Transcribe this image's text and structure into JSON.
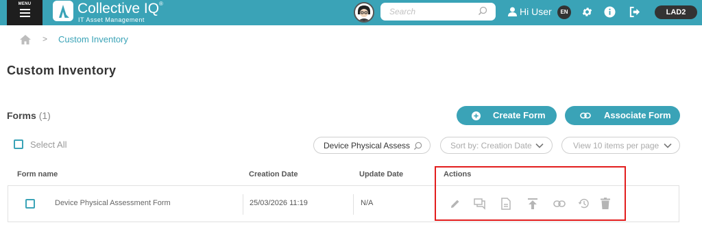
{
  "header": {
    "menu_label": "MENU",
    "app_title": "Collective IQ",
    "app_registered": "®",
    "app_subtitle": "IT Asset Management",
    "search_placeholder": "Search",
    "user_greeting": "Hi User",
    "language": "EN",
    "site_badge": "LAD2"
  },
  "breadcrumb": {
    "separator": ">",
    "current": "Custom Inventory"
  },
  "page": {
    "title": "Custom Inventory",
    "forms_label": "Forms",
    "forms_count": "(1)",
    "create_form": "Create Form",
    "associate_form": "Associate Form",
    "select_all": "Select All",
    "filter_value": "Device Physical Assessment Form",
    "sort_by": "Sort by: Creation Date",
    "view_items": "View 10 items per page"
  },
  "table": {
    "columns": [
      "Form name",
      "Creation Date",
      "Update Date",
      "Actions"
    ],
    "rows": [
      {
        "name": "Device Physical Assessment Form",
        "creation_date": "25/03/2026 11:19",
        "update_date": "N/A"
      }
    ],
    "action_icons": [
      "edit-icon",
      "comments-icon",
      "document-icon",
      "publish-icon",
      "link-icon",
      "history-icon",
      "delete-icon"
    ]
  },
  "colors": {
    "brand": "#3aa3b7",
    "highlight": "#e21c1c",
    "dark": "#1e1e1e"
  }
}
